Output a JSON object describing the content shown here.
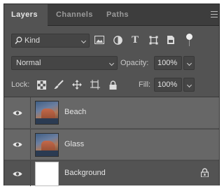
{
  "tabs": [
    {
      "label": "Layers",
      "active": true
    },
    {
      "label": "Channels",
      "active": false
    },
    {
      "label": "Paths",
      "active": false
    }
  ],
  "panel_menu_icon": "hamburger-menu-icon",
  "filter": {
    "kind_label": "Kind",
    "icons": [
      "pixel-layer-filter-icon",
      "adjustment-layer-filter-icon",
      "type-layer-filter-icon",
      "shape-layer-filter-icon",
      "smart-object-filter-icon",
      "filter-toggle-icon"
    ]
  },
  "blend": {
    "mode": "Normal",
    "opacity_label": "Opacity:",
    "opacity_value": "100%"
  },
  "lock": {
    "label": "Lock:",
    "icons": [
      "lock-transparent-pixels-icon",
      "lock-image-pixels-icon",
      "lock-position-icon",
      "prevent-auto-nesting-icon",
      "lock-all-icon"
    ],
    "fill_label": "Fill:",
    "fill_value": "100%"
  },
  "layers": [
    {
      "name": "Beach",
      "visible": true,
      "selected": true,
      "locked": false
    },
    {
      "name": "Glass",
      "visible": true,
      "selected": true,
      "locked": false
    },
    {
      "name": "Background",
      "visible": true,
      "selected": false,
      "locked": true
    }
  ],
  "colors": {
    "panel_bg": "#535353",
    "tabbar_bg": "#3d3d3d",
    "selected_row": "#676767",
    "field_bg": "#454545"
  }
}
